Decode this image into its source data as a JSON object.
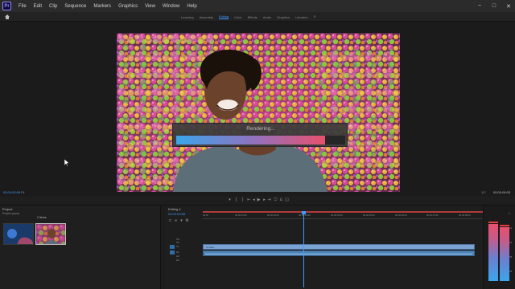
{
  "app": {
    "logo": "Pr",
    "accent": "#3d9bff"
  },
  "menu": {
    "items": [
      "File",
      "Edit",
      "Clip",
      "Sequence",
      "Markers",
      "Graphics",
      "View",
      "Window",
      "Help"
    ]
  },
  "window_controls": {
    "minimize": "−",
    "maximize": "□",
    "close": "✕"
  },
  "workspaces": {
    "tabs": [
      "Learning",
      "Assembly",
      "Editing",
      "Color",
      "Effects",
      "Audio",
      "Graphics",
      "Libraries"
    ],
    "active": "Editing",
    "more": "»"
  },
  "monitor": {
    "timecode": "00:00:03:08",
    "fit": "Fit",
    "quality": "1/2",
    "duration": "00:00:08:05"
  },
  "render_dialog": {
    "label": "Rendering...",
    "progress": 0.88
  },
  "project": {
    "tab": "Project",
    "path": "Project.prproj",
    "item_count": "2 Items"
  },
  "timeline": {
    "tab": "Editing 4",
    "timecode": "00:00:03:08",
    "ruler_ticks": [
      "00:00",
      "00:00:01:00",
      "00:00:02:00",
      "00:00:03:00",
      "00:00:04:00",
      "00:00:05:00",
      "00:00:06:00",
      "00:00:07:00",
      "00:00:08:00"
    ],
    "tracks": {
      "video": [
        "V3",
        "V2",
        "V1"
      ],
      "audio": [
        "A1",
        "A2",
        "A3"
      ]
    },
    "clip_video_label": "fx  video"
  },
  "meters": {
    "levels": [
      0.84,
      0.8
    ],
    "scale": [
      "0",
      "-12",
      "-24",
      "-36",
      "-48"
    ]
  },
  "icons": {
    "home": "home-icon",
    "cursor": "mouse-cursor-icon"
  }
}
